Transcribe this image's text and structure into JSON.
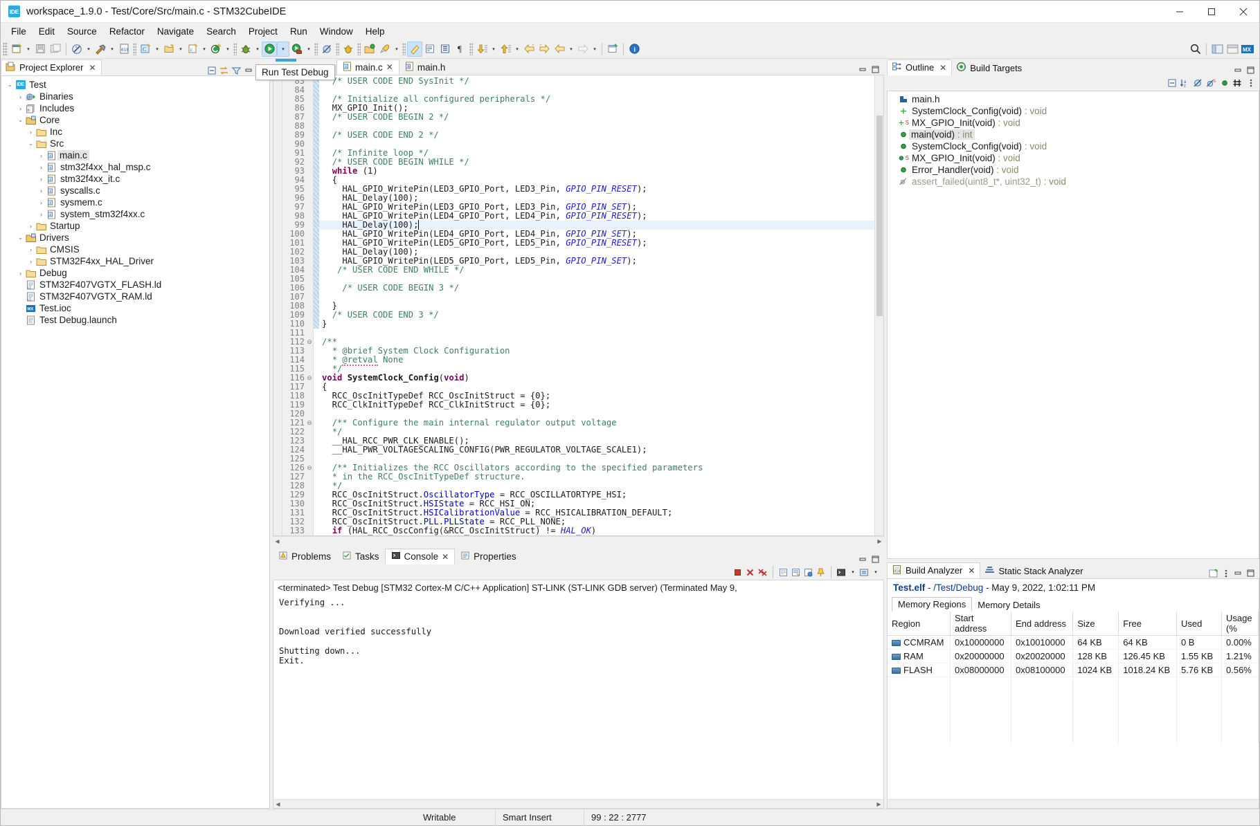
{
  "window": {
    "title": "workspace_1.9.0 - Test/Core/Src/main.c - STM32CubeIDE",
    "app_icon": "ide-icon",
    "minimize": "—",
    "maximize": "☐",
    "close": "✕"
  },
  "menu": [
    "File",
    "Edit",
    "Source",
    "Refactor",
    "Navigate",
    "Search",
    "Project",
    "Run",
    "Window",
    "Help"
  ],
  "tooltip": {
    "text": "Run Test Debug"
  },
  "project_explorer": {
    "title": "Project Explorer",
    "close": "✕",
    "tree": [
      {
        "label": "Test",
        "depth": 0,
        "arrow": "down",
        "icon": "ide-project-icon",
        "selected": false
      },
      {
        "label": "Binaries",
        "depth": 1,
        "arrow": "right",
        "icon": "binaries-icon",
        "selected": false
      },
      {
        "label": "Includes",
        "depth": 1,
        "arrow": "right",
        "icon": "includes-icon",
        "selected": false
      },
      {
        "label": "Core",
        "depth": 1,
        "arrow": "down",
        "icon": "source-folder-icon",
        "selected": false
      },
      {
        "label": "Inc",
        "depth": 2,
        "arrow": "right",
        "icon": "folder-icon",
        "selected": false
      },
      {
        "label": "Src",
        "depth": 2,
        "arrow": "down",
        "icon": "folder-icon",
        "selected": false
      },
      {
        "label": "main.c",
        "depth": 3,
        "arrow": "right",
        "icon": "c-file-icon",
        "selected": true
      },
      {
        "label": "stm32f4xx_hal_msp.c",
        "depth": 3,
        "arrow": "right",
        "icon": "c-file-icon",
        "selected": false
      },
      {
        "label": "stm32f4xx_it.c",
        "depth": 3,
        "arrow": "right",
        "icon": "c-file-icon",
        "selected": false
      },
      {
        "label": "syscalls.c",
        "depth": 3,
        "arrow": "right",
        "icon": "c-file-icon",
        "selected": false
      },
      {
        "label": "sysmem.c",
        "depth": 3,
        "arrow": "right",
        "icon": "c-file-icon",
        "selected": false
      },
      {
        "label": "system_stm32f4xx.c",
        "depth": 3,
        "arrow": "right",
        "icon": "c-file-icon",
        "selected": false
      },
      {
        "label": "Startup",
        "depth": 2,
        "arrow": "right",
        "icon": "folder-icon",
        "selected": false
      },
      {
        "label": "Drivers",
        "depth": 1,
        "arrow": "down",
        "icon": "source-folder-icon",
        "selected": false
      },
      {
        "label": "CMSIS",
        "depth": 2,
        "arrow": "right",
        "icon": "folder-icon",
        "selected": false
      },
      {
        "label": "STM32F4xx_HAL_Driver",
        "depth": 2,
        "arrow": "right",
        "icon": "folder-icon",
        "selected": false
      },
      {
        "label": "Debug",
        "depth": 1,
        "arrow": "right",
        "icon": "folder-icon",
        "selected": false
      },
      {
        "label": "STM32F407VGTX_FLASH.ld",
        "depth": 1,
        "arrow": "none",
        "icon": "ld-file-icon",
        "selected": false
      },
      {
        "label": "STM32F407VGTX_RAM.ld",
        "depth": 1,
        "arrow": "none",
        "icon": "ld-file-icon",
        "selected": false
      },
      {
        "label": "Test.ioc",
        "depth": 1,
        "arrow": "none",
        "icon": "ioc-file-icon",
        "selected": false
      },
      {
        "label": "Test Debug.launch",
        "depth": 1,
        "arrow": "none",
        "icon": "launch-file-icon",
        "selected": false
      }
    ]
  },
  "editor": {
    "tabs": [
      {
        "label": "main.c",
        "icon": "c-file-icon",
        "active": true,
        "closable": true
      },
      {
        "label": "main.h",
        "icon": "h-file-icon",
        "active": false,
        "closable": false
      }
    ],
    "first_line": 83,
    "current_line": 99,
    "lines": [
      {
        "n": 83,
        "fold": "",
        "mark": true,
        "html": "  <span class='cm'>/* USER CODE END SysInit */</span>"
      },
      {
        "n": 84,
        "fold": "",
        "mark": true,
        "html": ""
      },
      {
        "n": 85,
        "fold": "",
        "mark": true,
        "html": "  <span class='cm'>/* Initialize all configured peripherals */</span>"
      },
      {
        "n": 86,
        "fold": "",
        "mark": true,
        "html": "  MX_GPIO_Init();"
      },
      {
        "n": 87,
        "fold": "",
        "mark": true,
        "html": "  <span class='cm'>/* USER CODE BEGIN 2 */</span>"
      },
      {
        "n": 88,
        "fold": "",
        "mark": true,
        "html": ""
      },
      {
        "n": 89,
        "fold": "",
        "mark": true,
        "html": "  <span class='cm'>/* USER CODE END 2 */</span>"
      },
      {
        "n": 90,
        "fold": "",
        "mark": true,
        "html": ""
      },
      {
        "n": 91,
        "fold": "",
        "mark": true,
        "html": "  <span class='cm'>/* Infinite loop */</span>"
      },
      {
        "n": 92,
        "fold": "",
        "mark": true,
        "html": "  <span class='cm'>/* USER CODE BEGIN WHILE */</span>"
      },
      {
        "n": 93,
        "fold": "",
        "mark": true,
        "html": "  <span class='kw'>while</span> (1)"
      },
      {
        "n": 94,
        "fold": "",
        "mark": true,
        "html": "  {"
      },
      {
        "n": 95,
        "fold": "",
        "mark": true,
        "html": "    HAL_GPIO_WritePin(LED3_GPIO_Port, LED3_Pin, <span class='mac'>GPIO_PIN_RESET</span>);"
      },
      {
        "n": 96,
        "fold": "",
        "mark": true,
        "html": "    HAL_Delay(100);"
      },
      {
        "n": 97,
        "fold": "",
        "mark": true,
        "html": "    HAL_GPIO_WritePin(LED3_GPIO_Port, LED3_Pin, <span class='mac'>GPIO_PIN_SET</span>);"
      },
      {
        "n": 98,
        "fold": "",
        "mark": true,
        "html": "    HAL_GPIO_WritePin(LED4_GPIO_Port, LED4_Pin, <span class='mac'>GPIO_PIN_RESET</span>);"
      },
      {
        "n": 99,
        "fold": "",
        "mark": true,
        "cur": true,
        "html": "    HAL_Delay(100);"
      },
      {
        "n": 100,
        "fold": "",
        "mark": true,
        "html": "    HAL_GPIO_WritePin(LED4_GPIO_Port, LED4_Pin, <span class='mac'>GPIO_PIN_SET</span>);"
      },
      {
        "n": 101,
        "fold": "",
        "mark": true,
        "html": "    HAL_GPIO_WritePin(LED5_GPIO_Port, LED5_Pin, <span class='mac'>GPIO_PIN_RESET</span>);"
      },
      {
        "n": 102,
        "fold": "",
        "mark": true,
        "html": "    HAL_Delay(100);"
      },
      {
        "n": 103,
        "fold": "",
        "mark": true,
        "html": "    HAL_GPIO_WritePin(LED5_GPIO_Port, LED5_Pin, <span class='mac'>GPIO_PIN_SET</span>);"
      },
      {
        "n": 104,
        "fold": "",
        "mark": true,
        "html": "   <span class='cm'>/* USER CODE END WHILE */</span>"
      },
      {
        "n": 105,
        "fold": "",
        "mark": true,
        "html": ""
      },
      {
        "n": 106,
        "fold": "",
        "mark": true,
        "html": "    <span class='cm'>/* USER CODE BEGIN 3 */</span>"
      },
      {
        "n": 107,
        "fold": "",
        "mark": true,
        "html": ""
      },
      {
        "n": 108,
        "fold": "",
        "mark": true,
        "html": "  }"
      },
      {
        "n": 109,
        "fold": "",
        "mark": true,
        "html": "  <span class='cm'>/* USER CODE END 3 */</span>"
      },
      {
        "n": 110,
        "fold": "",
        "mark": true,
        "html": "}"
      },
      {
        "n": 111,
        "fold": "",
        "mark": false,
        "html": ""
      },
      {
        "n": 112,
        "fold": "⊖",
        "mark": false,
        "html": "<span class='cm'>/**</span>"
      },
      {
        "n": 113,
        "fold": "",
        "mark": false,
        "html": "  <span class='cm'>* @brief System Clock Configuration</span>"
      },
      {
        "n": 114,
        "fold": "",
        "mark": false,
        "html": "  <span class='cm'>* <span class='squig'>@retval</span> None</span>"
      },
      {
        "n": 115,
        "fold": "",
        "mark": false,
        "html": "  <span class='cm'>*/</span>"
      },
      {
        "n": 116,
        "fold": "⊖",
        "mark": false,
        "html": "<span class='kw'>void</span> <b>SystemClock_Config</b>(<span class='kw'>void</span>)"
      },
      {
        "n": 117,
        "fold": "",
        "mark": false,
        "html": "{"
      },
      {
        "n": 118,
        "fold": "",
        "mark": false,
        "html": "  RCC_OscInitTypeDef RCC_OscInitStruct = {0};"
      },
      {
        "n": 119,
        "fold": "",
        "mark": false,
        "html": "  RCC_ClkInitTypeDef RCC_ClkInitStruct = {0};"
      },
      {
        "n": 120,
        "fold": "",
        "mark": false,
        "html": ""
      },
      {
        "n": 121,
        "fold": "⊖",
        "mark": false,
        "html": "  <span class='cm'>/** Configure the main internal regulator output voltage</span>"
      },
      {
        "n": 122,
        "fold": "",
        "mark": false,
        "html": "  <span class='cm'>*/</span>"
      },
      {
        "n": 123,
        "fold": "",
        "mark": false,
        "html": "  __HAL_RCC_PWR_CLK_ENABLE();"
      },
      {
        "n": 124,
        "fold": "",
        "mark": false,
        "html": "  __HAL_PWR_VOLTAGESCALING_CONFIG(PWR_REGULATOR_VOLTAGE_SCALE1);"
      },
      {
        "n": 125,
        "fold": "",
        "mark": false,
        "html": ""
      },
      {
        "n": 126,
        "fold": "⊖",
        "mark": false,
        "html": "  <span class='cm'>/** Initializes the RCC Oscillators according to the specified parameters</span>"
      },
      {
        "n": 127,
        "fold": "",
        "mark": false,
        "html": "  <span class='cm'>* in the RCC_OscInitTypeDef structure.</span>"
      },
      {
        "n": 128,
        "fold": "",
        "mark": false,
        "html": "  <span class='cm'>*/</span>"
      },
      {
        "n": 129,
        "fold": "",
        "mark": false,
        "html": "  RCC_OscInitStruct.<span class='fld'>OscillatorType</span> = RCC_OSCILLATORTYPE_HSI;"
      },
      {
        "n": 130,
        "fold": "",
        "mark": false,
        "html": "  RCC_OscInitStruct.<span class='fld'>HSIState</span> = RCC_HSI_ON;"
      },
      {
        "n": 131,
        "fold": "",
        "mark": false,
        "html": "  RCC_OscInitStruct.<span class='fld'>HSICalibrationValue</span> = RCC_HSICALIBRATION_DEFAULT;"
      },
      {
        "n": 132,
        "fold": "",
        "mark": false,
        "html": "  RCC_OscInitStruct.<span class='fld'>PLL.PLLState</span> = RCC_PLL_NONE;"
      },
      {
        "n": 133,
        "fold": "",
        "mark": false,
        "html": "  <span class='kw'>if</span> (HAL_RCC_OscConfig(&amp;RCC_OscInitStruct) != <span class='mac'>HAL_OK</span>)"
      }
    ]
  },
  "outline": {
    "tabs": [
      {
        "label": "Outline",
        "icon": "outline-icon",
        "active": true,
        "closable": true
      },
      {
        "label": "Build Targets",
        "icon": "build-targets-icon",
        "active": false,
        "closable": false
      }
    ],
    "items": [
      {
        "label": "main.h",
        "icon": "header-include-icon",
        "static": false,
        "selected": false,
        "ret": ""
      },
      {
        "label": "SystemClock_Config(void)",
        "ret": " : void",
        "icon": "prototype-icon",
        "static": false,
        "selected": false
      },
      {
        "label": "MX_GPIO_Init(void)",
        "ret": " : void",
        "icon": "prototype-icon",
        "static": true,
        "selected": false
      },
      {
        "label": "main(void)",
        "ret": " : int",
        "icon": "function-icon",
        "static": false,
        "selected": true
      },
      {
        "label": "SystemClock_Config(void)",
        "ret": " : void",
        "icon": "function-icon",
        "static": false,
        "selected": false
      },
      {
        "label": "MX_GPIO_Init(void)",
        "ret": " : void",
        "icon": "function-icon",
        "static": true,
        "selected": false
      },
      {
        "label": "Error_Handler(void)",
        "ret": " : void",
        "icon": "function-icon",
        "static": false,
        "selected": false
      },
      {
        "label": "assert_failed(uint8_t*, uint32_t)",
        "ret": " : void",
        "icon": "disabled-function-icon",
        "static": false,
        "selected": false
      }
    ]
  },
  "console": {
    "tabs": [
      {
        "label": "Problems",
        "icon": "problems-icon",
        "active": false
      },
      {
        "label": "Tasks",
        "icon": "tasks-icon",
        "active": false
      },
      {
        "label": "Console",
        "icon": "console-icon",
        "active": true,
        "closable": true
      },
      {
        "label": "Properties",
        "icon": "properties-icon",
        "active": false
      }
    ],
    "header": "<terminated> Test Debug [STM32 Cortex-M C/C++ Application] ST-LINK (ST-LINK GDB server) (Terminated May 9,",
    "text": "Verifying ...\n\n\nDownload verified successfully\n\nShutting down...\nExit."
  },
  "build_analyzer": {
    "tabs": [
      {
        "label": "Build Analyzer",
        "icon": "build-analyzer-icon",
        "active": true,
        "closable": true
      },
      {
        "label": "Static Stack Analyzer",
        "icon": "static-stack-icon",
        "active": false
      }
    ],
    "title_file": "Test.elf",
    "title_sep": " - ",
    "title_path": "/Test/Debug",
    "title_date": " - May 9, 2022, 1:02:11 PM",
    "subtabs": [
      {
        "label": "Memory Regions",
        "active": true
      },
      {
        "label": "Memory Details",
        "active": false
      }
    ],
    "columns": [
      "Region",
      "Start address",
      "End address",
      "Size",
      "Free",
      "Used",
      "Usage (%"
    ],
    "rows": [
      {
        "region": "CCMRAM",
        "start": "0x10000000",
        "end": "0x10010000",
        "size": "64 KB",
        "free": "64 KB",
        "used": "0 B",
        "usage": "0.00%"
      },
      {
        "region": "RAM",
        "start": "0x20000000",
        "end": "0x20020000",
        "size": "128 KB",
        "free": "126.45 KB",
        "used": "1.55 KB",
        "usage": "1.21%"
      },
      {
        "region": "FLASH",
        "start": "0x08000000",
        "end": "0x08100000",
        "size": "1024 KB",
        "free": "1018.24 KB",
        "used": "5.76 KB",
        "usage": "0.56%"
      }
    ]
  },
  "statusbar": {
    "writable": "Writable",
    "insert_mode": "Smart Insert",
    "position": "99 : 22 : 2777"
  }
}
